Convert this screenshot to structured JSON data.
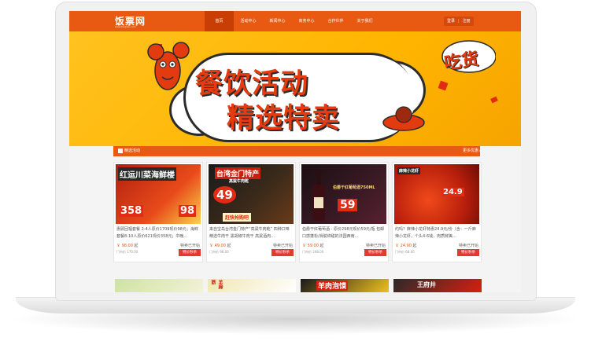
{
  "site": {
    "logo": "饭票网",
    "logo_sub": "www.fanpiao.com"
  },
  "nav": {
    "items": [
      "首页",
      "活动中心",
      "新闻中心",
      "商务中心",
      "合作伙伴",
      "关于我们"
    ],
    "active_index": 0
  },
  "auth": {
    "login": "登录",
    "register": "注册"
  },
  "banner": {
    "headline1": "餐饮活动",
    "headline2": "精选特卖",
    "foodie": "吃货",
    "active_slide": 1,
    "slide_count": 3
  },
  "section": {
    "title": "精选活动",
    "more": "更多优惠 ▸"
  },
  "cards": [
    {
      "title_overlay": "红运川菜海鲜楼",
      "price_tag": "358",
      "price_tag2": "98",
      "desc": "惠顾回福套餐 2-4人原价1709现价98元；海鲜套餐8-10人原价621现价358元；中晚...",
      "price": "￥ 98.00",
      "unit": "起",
      "orig": "门市价 170.00",
      "status": "特卖已开始",
      "btn": "特价秒杀"
    },
    {
      "title_overlay": "台湾金门特产",
      "subtitle_overlay": "高粱牛肉乾",
      "price_tag": "49",
      "promo": "赶快抢购吧",
      "desc": "来自宝岛台湾金门特产“高粱牛肉乾” 四种口味 精选牛肉干 黑胡椒牛肉干 高粱酒肉...",
      "price": "￥ 49.00",
      "unit": "起",
      "orig": "门市价 98.00",
      "status": "特卖已开始",
      "btn": "特价秒杀"
    },
    {
      "title_overlay": "伯爵干红葡萄酒750ML",
      "price_tag": "59",
      "desc": "伯爵干红葡萄酒 - 原价298元现价59元/瓶 包邮口感蓬松/滑腻绵甜的法国西南...",
      "price": "￥ 59.00",
      "unit": "起",
      "orig": "门市价 298.00",
      "status": "特卖已开始",
      "btn": "特价秒杀"
    },
    {
      "title_overlay": "麻辣小龙虾",
      "price_tag": "24.9",
      "desc": "约吗？麻辣小龙虾特惠24.9元/份（含：一斤麻辣小龙虾，个头4-6钱，肉质鲜美...",
      "price": "￥ 24.90",
      "unit": "起",
      "orig": "门市价 68.00",
      "status": "特卖已开始",
      "btn": "特价秒杀"
    }
  ],
  "row2": [
    {
      "label": ""
    },
    {
      "label": "羊蹄筋"
    },
    {
      "label": "羊肉泡馍"
    },
    {
      "label": "王府井"
    }
  ],
  "colors": {
    "accent": "#e85a12",
    "btn": "#e23b2e",
    "banner": "#ffb500"
  }
}
